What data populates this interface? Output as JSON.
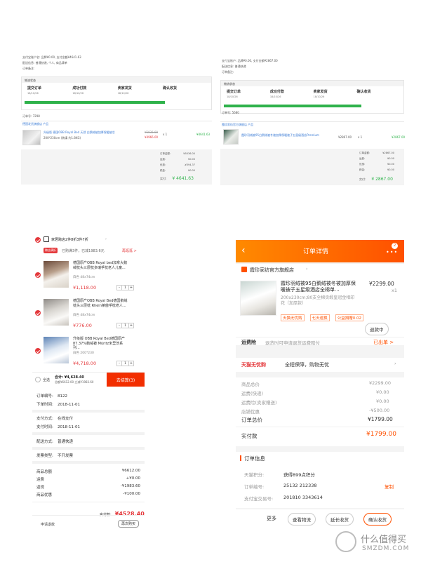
{
  "panel1": {
    "info_lines": [
      "支付宝账户名: 品牌¥0.00, 支付金额¥4641.63",
      "配送信息: 普通快递, 个人, 商品清单",
      "订单备注:"
    ],
    "tab_label": "物流状态",
    "steps": [
      {
        "label": "提交订单",
        "date": "18/10/26"
      },
      {
        "label": "成功付款",
        "date": "18/10/26"
      },
      {
        "label": "卖家发货",
        "date": "18/10/26"
      },
      {
        "label": "确认收货",
        "date": ""
      }
    ],
    "order_no": "订单号: 7298",
    "shop_bar": "德国发货旗舰店 产品",
    "product_title": "升级版 德国OBB Royal Bed 天然 白鹅绒被加厚保暖被芯",
    "product_spec": "200*230cm (装填 约1.8KG)",
    "orig_price": "¥5036.00",
    "sale_price": "¥4966.00",
    "qty": "x 1",
    "line_total": "¥4641.63",
    "summary": [
      {
        "k": "订单金额:",
        "v": "¥5036.00"
      },
      {
        "k": "运费:",
        "v": "¥0.00"
      },
      {
        "k": "优惠:",
        "v": "-¥394.37"
      },
      {
        "k": "税金:",
        "v": "¥0.00"
      },
      {
        "k": "实付:",
        "v": "¥0.00"
      }
    ],
    "paid_label": "实付:",
    "paid_total": "¥ 4641.63"
  },
  "panel2": {
    "info_lines": [
      "支付宝账户: 品牌¥0.00, 支付金额¥2867.00",
      "配送信息: 普通快递",
      "订单备注:"
    ],
    "tab_label": "物流状态",
    "steps": [
      {
        "label": "提交订单",
        "date": "18/10/26"
      },
      {
        "label": "成功付款",
        "date": "18/10/26"
      },
      {
        "label": "卖家发货",
        "date": "18/10/26"
      },
      {
        "label": "确认收货",
        "date": ""
      }
    ],
    "order_no": "订单号: 5680",
    "shop_bar": "霞珍家纺官方旗舰店 产品",
    "product_title": "霞珍羽绒被95白鹅绒被冬被加厚保暖被子五星级酒店Premium",
    "orig_price": "¥2867.00",
    "qty": "x 1",
    "line_total": "¥2867.00",
    "summary": [
      {
        "k": "订单金额:",
        "v": "¥2867.00"
      },
      {
        "k": "运费:",
        "v": "¥0.00"
      },
      {
        "k": "优惠:",
        "v": "¥0.00"
      },
      {
        "k": "税金:",
        "v": "¥0.00"
      },
      {
        "k": "实付:",
        "v": "¥0.00"
      }
    ],
    "paid_label": "实付:",
    "paid_total": "¥ 2867.00"
  },
  "panel3": {
    "shop_name": "家居跨店2件8折3件7折",
    "promo_badge": "跨店满折",
    "promo_text": "已购满3件，已减1983.6元",
    "promo_link": "再逛逛 >",
    "items": [
      {
        "title": "德国原产OBB Royal bed加拿大鹅绒枕头三层枕多瑞孚枕老人儿童...",
        "sku": "白色 48x74cm",
        "price": "¥1,118.00",
        "qty": "1"
      },
      {
        "title": "德国原产OBB Royal Bed德国鹅绒枕头三层枕 Rhein莱茵孚枕老人...",
        "sku": "白色 48x74cm",
        "price": "¥776.00",
        "qty": "1"
      },
      {
        "title": "升级版 OBB Royal Bed德国原产87.37%鹅绒被 Müritz米里茨系列...",
        "sku": "白色 200*230",
        "price": "¥4,718.00",
        "qty": "1"
      }
    ],
    "select_all": "全选",
    "total_line": "合计: ¥4,628.40",
    "total_sub": "总额¥6612.00 立减¥1983.60",
    "settle_button": "去结算(3)",
    "order_info": [
      {
        "k": "订单编号:",
        "v": "8122"
      },
      {
        "k": "下单时间:",
        "v": "2018-11-01"
      }
    ],
    "pay_info": [
      {
        "k": "支付方式:",
        "v": "在线支付"
      },
      {
        "k": "支付时间:",
        "v": "2018-11-01"
      }
    ],
    "delivery": {
      "k": "配送方式:",
      "v": "普通快递"
    },
    "invoice": {
      "k": "发票类型:",
      "v": "不开发票"
    },
    "amounts": [
      {
        "k": "商品总额",
        "v": "¥6612.00"
      },
      {
        "k": "运费",
        "v": "+¥0.00"
      },
      {
        "k": "返现",
        "v": "-¥1983.60"
      },
      {
        "k": "商品优惠",
        "v": "-¥100.00"
      }
    ],
    "paid_label": "实付款:",
    "paid_value": "¥4528.40",
    "refund_link": "申请退款",
    "rebuy_button": "再次购买"
  },
  "panel4": {
    "header_title": "订单详情",
    "badge_count": "2",
    "shop_name": "霞珍家纺官方旗舰店",
    "product_title": "霞珍羽绒被95白鹅绒被冬被加厚保暖被子五星级酒店全棉单...",
    "product_price": "¥2299.00",
    "product_qty": "x1",
    "product_spec": "200x230cm;80支全棉贡缎皇冠金相印花（加厚款）",
    "tags": [
      "天猫无忧购",
      "七天退换",
      "公益捐赠0.02"
    ],
    "refund_button": "退款中",
    "insurance_label": "运费险",
    "insurance_text": "退货时可申请退货运费赔付",
    "insurance_status": "已出单 >",
    "tmall_logo": "天猫无忧购",
    "tmall_text": "全程保障，购物无忧",
    "amounts": [
      {
        "k": "商品总价",
        "v": "¥2299.00"
      },
      {
        "k": "运费(快递)",
        "v": "¥0.00"
      },
      {
        "k": "运费险(卖家赠送)",
        "v": "¥0.00"
      },
      {
        "k": "店铺优惠",
        "v": "-¥500.00"
      }
    ],
    "order_total_label": "订单总价",
    "order_total_value": "¥1799.00",
    "paid_label": "实付款",
    "paid_value": "¥1799.00",
    "info_title": "订单信息",
    "points_label": "天猫积分:",
    "points_value": "获得899点积分",
    "order_no_label": "订单编号:",
    "order_no_value": "25132   212338",
    "copy_link": "复制",
    "alipay_label": "支付宝交易号:",
    "alipay_value": "201810   3343614",
    "more_label": "更多",
    "btn_logistics": "查看物流",
    "btn_extend": "延长收货",
    "btn_confirm": "确认收货"
  },
  "watermark": {
    "main": "什么值得买",
    "sub": "SMZDM.COM"
  }
}
